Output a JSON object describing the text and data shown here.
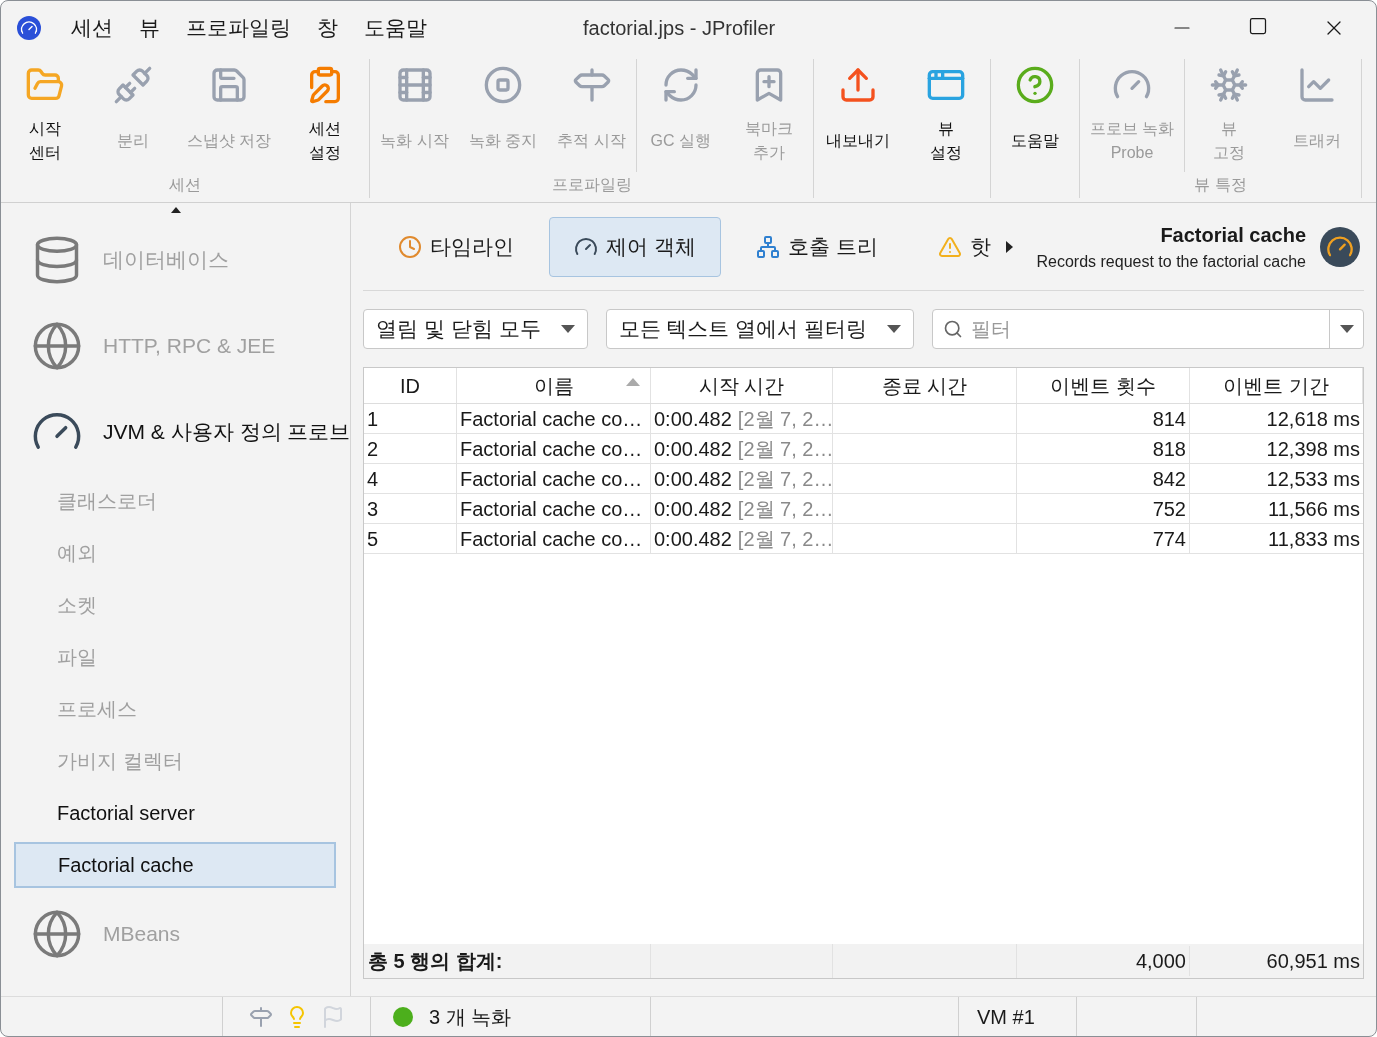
{
  "window": {
    "title": "factorial.jps - JProfiler"
  },
  "menu": [
    "세션",
    "뷰",
    "프로파일링",
    "창",
    "도움말"
  ],
  "toolbar": {
    "groups": [
      {
        "label": "세션",
        "sections": [
          [
            {
              "lines": [
                "시작",
                "센터"
              ],
              "disabled": false
            },
            {
              "lines": [
                "분리"
              ],
              "disabled": true
            },
            {
              "lines": [
                "스냅샷 저장"
              ],
              "disabled": true
            },
            {
              "lines": [
                "세션",
                "설정"
              ],
              "disabled": false
            }
          ]
        ]
      },
      {
        "label": "프로파일링",
        "sections": [
          [
            {
              "lines": [
                "녹화 시작"
              ],
              "disabled": true
            },
            {
              "lines": [
                "녹화 중지"
              ],
              "disabled": true
            },
            {
              "lines": [
                "추적 시작"
              ],
              "disabled": true
            }
          ],
          [
            {
              "lines": [
                "GC 실행"
              ],
              "disabled": true
            },
            {
              "lines": [
                "북마크",
                "추가"
              ],
              "disabled": true
            }
          ]
        ]
      },
      {
        "sections": [
          [
            {
              "lines": [
                "내보내기"
              ],
              "disabled": false
            },
            {
              "lines": [
                "뷰",
                "설정"
              ],
              "disabled": false
            }
          ]
        ]
      },
      {
        "sections": [
          [
            {
              "lines": [
                "도움말"
              ],
              "disabled": false
            }
          ]
        ]
      },
      {
        "label": "뷰 특정",
        "sections": [
          [
            {
              "lines": [
                "프로브 녹화",
                "Probe"
              ],
              "disabled": true
            }
          ],
          [
            {
              "lines": [
                "뷰",
                "고정"
              ],
              "disabled": true
            },
            {
              "lines": [
                "트래커"
              ],
              "disabled": true
            }
          ]
        ]
      }
    ]
  },
  "sidebar": {
    "items": [
      {
        "label": "데이터베이스",
        "disabled": true
      },
      {
        "label": "HTTP, RPC & JEE",
        "disabled": true
      },
      {
        "label": "JVM & 사용자 정의 프로브",
        "disabled": false,
        "children": [
          {
            "label": "클래스로더",
            "disabled": true,
            "selected": false
          },
          {
            "label": "예외",
            "disabled": true,
            "selected": false
          },
          {
            "label": "소켓",
            "disabled": true,
            "selected": false
          },
          {
            "label": "파일",
            "disabled": true,
            "selected": false
          },
          {
            "label": "프로세스",
            "disabled": true,
            "selected": false
          },
          {
            "label": "가비지 컬렉터",
            "disabled": true,
            "selected": false
          },
          {
            "label": "Factorial server",
            "disabled": false,
            "selected": false
          },
          {
            "label": "Factorial cache",
            "disabled": false,
            "selected": true
          }
        ]
      },
      {
        "label": "MBeans",
        "disabled": true
      }
    ]
  },
  "tabs": [
    {
      "label": "타임라인",
      "selected": false
    },
    {
      "label": "제어 객체",
      "selected": true
    },
    {
      "label": "호출 트리",
      "selected": false
    },
    {
      "label": "핫",
      "selected": false
    }
  ],
  "probe": {
    "title": "Factorial cache",
    "description": "Records request to the factorial cache"
  },
  "filters": {
    "dropdowns": [
      "열림 및 닫힘 모두",
      "모든 텍스트 열에서 필터링"
    ],
    "search": {
      "placeholder": "필터"
    }
  },
  "table": {
    "columns": [
      {
        "label": "ID",
        "sorted": false
      },
      {
        "label": "이름",
        "sorted": true
      },
      {
        "label": "시작 시간",
        "sorted": false
      },
      {
        "label": "종료 시간",
        "sorted": false
      },
      {
        "label": "이벤트 횟수",
        "sorted": false
      },
      {
        "label": "이벤트 기간",
        "sorted": false
      }
    ],
    "rows": [
      {
        "id": "1",
        "name": "Factorial cache co…",
        "start_time": "0:00.482",
        "start_date": "[2월 7, 2…",
        "end_time": "",
        "count": "814",
        "duration": "12,618 ms"
      },
      {
        "id": "2",
        "name": "Factorial cache co…",
        "start_time": "0:00.482",
        "start_date": "[2월 7, 2…",
        "end_time": "",
        "count": "818",
        "duration": "12,398 ms"
      },
      {
        "id": "4",
        "name": "Factorial cache co…",
        "start_time": "0:00.482",
        "start_date": "[2월 7, 2…",
        "end_time": "",
        "count": "842",
        "duration": "12,533 ms"
      },
      {
        "id": "3",
        "name": "Factorial cache co…",
        "start_time": "0:00.482",
        "start_date": "[2월 7, 2…",
        "end_time": "",
        "count": "752",
        "duration": "11,566 ms"
      },
      {
        "id": "5",
        "name": "Factorial cache co…",
        "start_time": "0:00.482",
        "start_date": "[2월 7, 2…",
        "end_time": "",
        "count": "774",
        "duration": "11,833 ms"
      }
    ],
    "footer": {
      "label": "총 5 행의 합계:",
      "count": "4,000",
      "duration": "60,951 ms"
    }
  },
  "status_bar": {
    "recordings": "3 개 녹화",
    "vm": "VM #1"
  }
}
